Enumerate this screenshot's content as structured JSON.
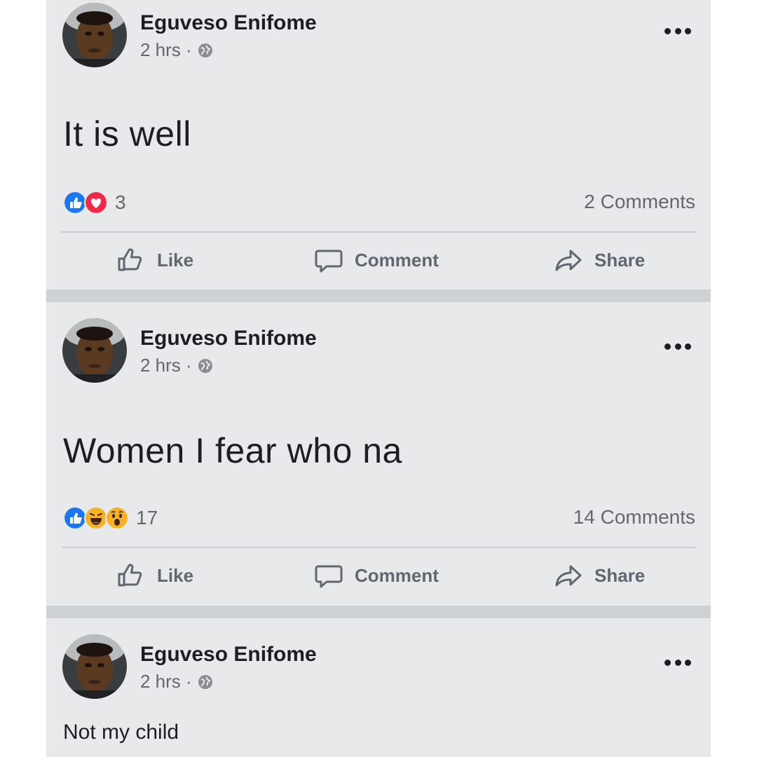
{
  "posts": [
    {
      "author": "Eguveso Enifome",
      "time": "2 hrs ·",
      "privacy_icon": "globe-icon",
      "text": "It is well",
      "reactions": [
        "like",
        "love"
      ],
      "reaction_count": "3",
      "comments": "2 Comments"
    },
    {
      "author": "Eguveso Enifome",
      "time": "2 hrs ·",
      "privacy_icon": "globe-icon",
      "text": "Women I fear who na",
      "reactions": [
        "like",
        "haha",
        "wow"
      ],
      "reaction_count": "17",
      "comments": "14 Comments"
    },
    {
      "author": "Eguveso Enifome",
      "time": "2 hrs ·",
      "privacy_icon": "globe-icon",
      "text": "Not my child"
    }
  ],
  "actions": {
    "like": "Like",
    "comment": "Comment",
    "share": "Share"
  },
  "colors": {
    "card": "#e8e9ea",
    "separator": "#cfd2d4",
    "like_blue": "#1877f2",
    "love_red": "#f02849",
    "haha_yellow": "#f7b125",
    "text": "#1c1e21",
    "muted": "#65676b"
  }
}
